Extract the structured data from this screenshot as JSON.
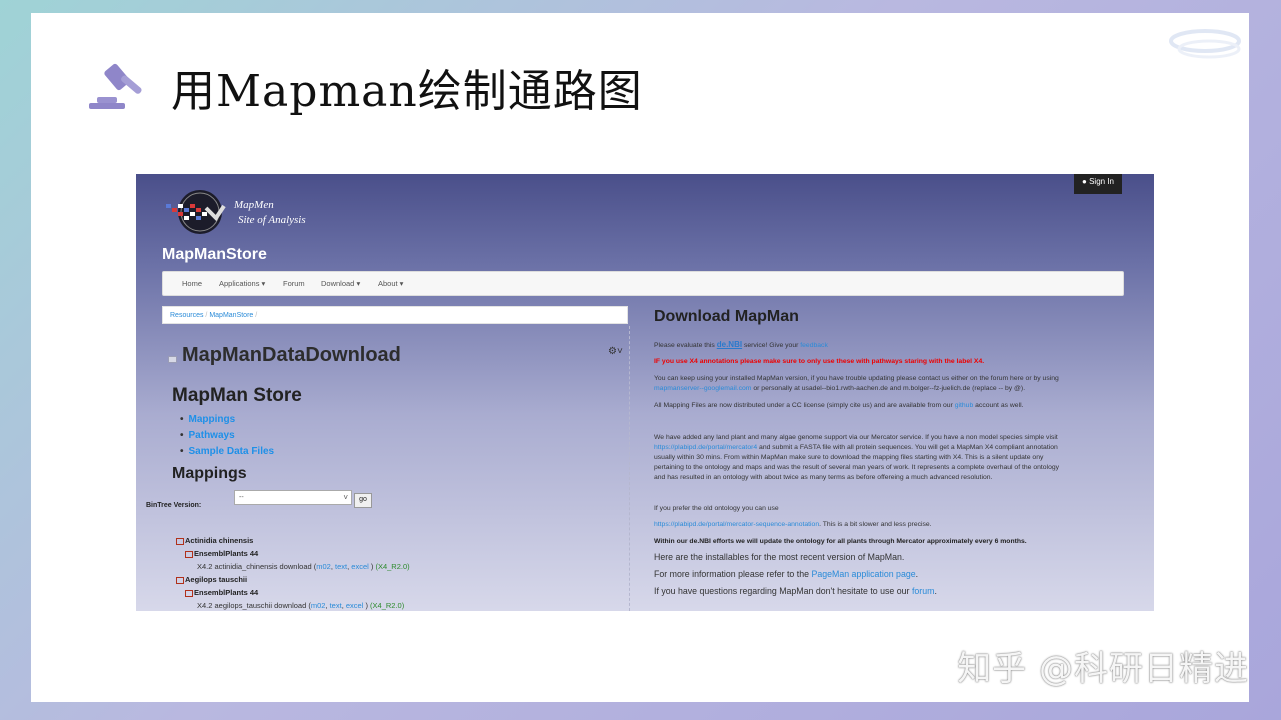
{
  "slide": {
    "title": "用Mapman绘制通路图",
    "watermark": "知乎 @科研日精进"
  },
  "site": {
    "signin": "Sign In",
    "brand_line1": "MapMen",
    "brand_line2": "Site of Analysis",
    "store_title": "MapManStore"
  },
  "nav": {
    "items": [
      "Home",
      "Applications ▾",
      "Forum",
      "Download ▾",
      "About ▾"
    ]
  },
  "breadcrumb": {
    "resources": "Resources",
    "sep": "/",
    "mapmanstore": "MapManStore"
  },
  "left": {
    "title": "MapManDataDownload",
    "store": "MapMan Store",
    "links": [
      "Mappings",
      "Pathways",
      "Sample Data Files"
    ],
    "mappings_heading": "Mappings",
    "bintree_label": "BinTree Version:",
    "bintree_value": "--",
    "go": "go",
    "tree": [
      {
        "species": "Actinidia chinensis",
        "source": "EnsemblPlants 44",
        "download": "X4.2 actinidia_chinensis download (",
        "links": [
          "m02",
          "text",
          "excel"
        ],
        "version": "(X4_R2.0)"
      },
      {
        "species": "Aegilops tauschii",
        "source": "EnsemblPlants 44",
        "download": "X4.2 aegilops_tauschii download (",
        "links": [
          "m02",
          "text",
          "excel"
        ],
        "version": "(X4_R2.0)"
      }
    ]
  },
  "right": {
    "title": "Download MapMan",
    "evaluate_pre": "Please evaluate this",
    "denbi": "de.NBI",
    "evaluate_post": "service! Give your",
    "feedback": "feedback",
    "warning": "IF you use X4 annotations please make sure to only use these with pathways staring with the label X4.",
    "p1": "You can keep using your installed MapMan version, if you have trouble updating please contact us either on the forum here or  by using",
    "p1_link": "mapmanserver--googlemail.com",
    "p1_post": " or personally at usadel--bio1.rwth-aachen.de and m.bolger--fz-juelich.de (replace -- by @).",
    "p2_pre": "All Mapping Files are now distributed under a CC license (simply cite us) and are available from our ",
    "p2_link": "github",
    "p2_post": " account as well.",
    "p3_a": "We have added any land plant and many algae genome support via our Mercator service. If you have a non model species simple visit",
    "p3_link": "https://plabipd.de/portal/mercator4",
    "p3_b": " and submit a FASTA file with all protein sequences. You will get a MapMan X4 compliant annotation",
    "p3_c": "usually within 30 mins. From within MapMan make sure to download the mapping files starting with X4. This is a silent update ony",
    "p3_d": "pertaining to the ontology and maps and was the result of several man years of work. It represents a complete overhaul of the ontology",
    "p3_e": "and has resulted in an ontology with about twice as many terms as before offereing a much advanced resolution.",
    "p4": "If you prefer the old ontology you can use",
    "p5_link": "https://plabipd.de/portal/mercator-sequence-annotation",
    "p5_post": ". This is a bit slower and less precise.",
    "p6": "Within our de.NBI efforts we will update the ontology for all plants through Mercator approximately every 6 months.",
    "p7": "Here are the installables for the most recent version of MapMan.",
    "p8_pre": "For more information please refer to the ",
    "p8_link": "PageMan application page",
    "p8_post": ".",
    "p9_pre": "If you have questions regarding MapMan don't hesitate to use our ",
    "p9_link": "forum",
    "p9_post": "."
  },
  "colors": {
    "accent": "#2a8bd8",
    "warning": "#ee0000",
    "header_dark": "#4a4f8a"
  }
}
